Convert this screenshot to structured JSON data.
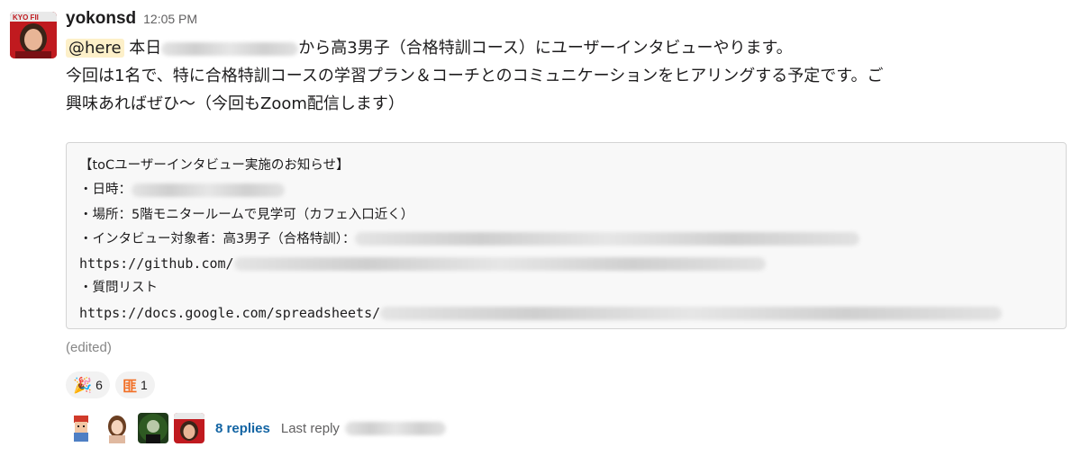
{
  "message": {
    "author": "yokonsd",
    "time": "12:05 PM",
    "mention": "@here",
    "line1_prefix": "本日",
    "line1_suffix": "から高3男子（合格特訓コース）にユーザーインタビューやります。",
    "line2": "今回は1名で、特に合格特訓コースの学習プラン＆コーチとのコミュニケーションをヒアリングする予定です。ご",
    "line3": "興味あればぜひ〜（今回もZoom配信します）"
  },
  "codeblock": {
    "line1": "【toCユーザーインタビュー実施のお知らせ】",
    "line2": "・日時：",
    "line3": "・場所：5階モニタールームで見学可（カフェ入口近く）",
    "line4": "・インタビュー対象者：高3男子（合格特訓）：",
    "line5": "https://github.com/",
    "line6": "・質問リスト",
    "line7": "https://docs.google.com/spreadsheets/"
  },
  "edited": "(edited)",
  "reactions": [
    {
      "icon": "party-popper-icon",
      "glyph": "🎉",
      "count": "6"
    },
    {
      "icon": "kanji-hi-icon",
      "glyph": "匪",
      "count": "1"
    }
  ],
  "thread": {
    "replies": "8 replies",
    "last_reply_label": "Last reply"
  },
  "colors": {
    "link": "#1264a3",
    "mention_bg": "#fdf0c9",
    "code_bg": "#f8f8f8",
    "reaction_bg": "#f2f2f2"
  }
}
